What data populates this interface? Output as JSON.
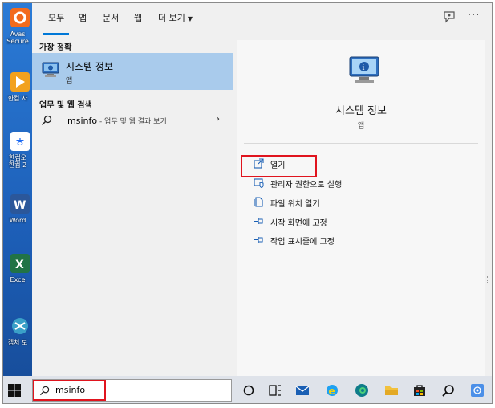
{
  "desktop": {
    "icons": [
      {
        "label": "Avas",
        "label2": "Secure",
        "name": "avast-icon",
        "color": "#f26b1d"
      },
      {
        "label": "한컴 사",
        "label2": "",
        "name": "hancom-office-icon",
        "color": "#f2a11d"
      },
      {
        "label": "한컴오",
        "label2": "한컴 2",
        "name": "hancom-tools-icon",
        "color": "#1d8af2"
      },
      {
        "label": "Word",
        "label2": "",
        "name": "word-icon",
        "color": "#2b579a"
      },
      {
        "label": "Exce",
        "label2": "",
        "name": "excel-icon",
        "color": "#217346"
      },
      {
        "label": "캡처 도",
        "label2": "",
        "name": "snipping-tool-icon",
        "color": "#3aa0c8"
      }
    ]
  },
  "tabs": {
    "all": "모두",
    "apps": "앱",
    "documents": "문서",
    "web": "웹",
    "more": "더 보기"
  },
  "left": {
    "best_match_heading": "가장 정확",
    "best_match": {
      "title": "시스템 정보",
      "subtitle": "앱"
    },
    "web_heading": "업무 및 웹 검색",
    "web_item": {
      "query": "msinfo",
      "hint": " - 업무 및 웹 결과 보기"
    }
  },
  "detail": {
    "title": "시스템 정보",
    "subtitle": "앱",
    "actions": {
      "open": "열기",
      "run_as_admin": "관리자 권한으로 실행",
      "open_location": "파일 위치 열기",
      "pin_start": "시작 화면에 고정",
      "pin_taskbar": "작업 표시줄에 고정"
    }
  },
  "taskbar": {
    "search_value": "msinfo"
  },
  "colors": {
    "accent": "#0078d7",
    "highlight_box": "#e0141e",
    "selection": "#a9cbec"
  }
}
